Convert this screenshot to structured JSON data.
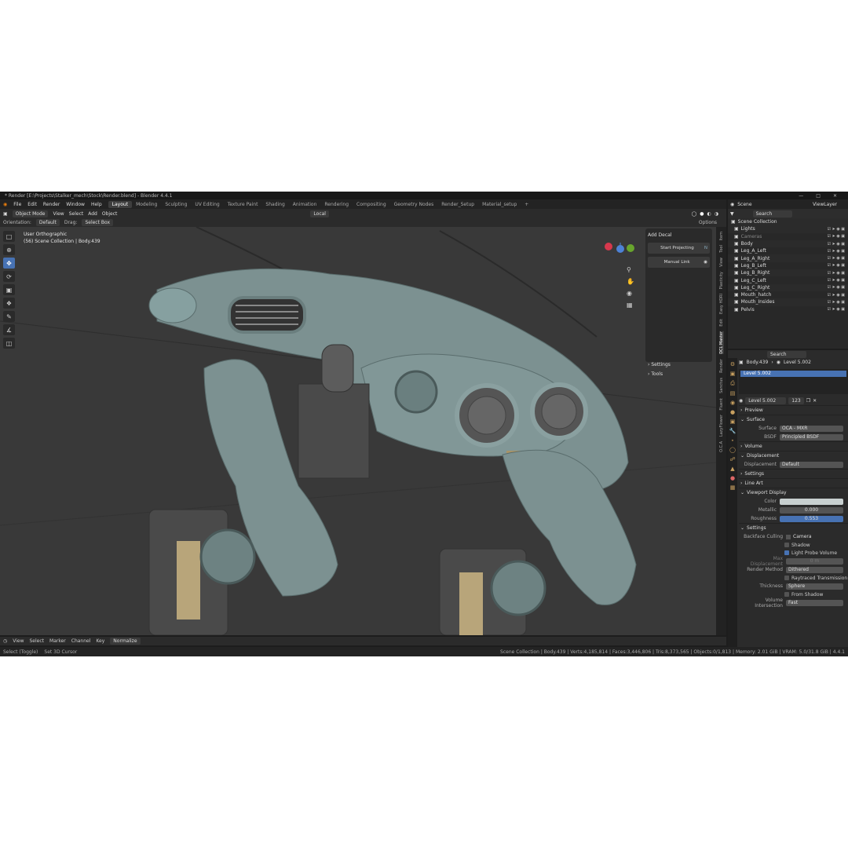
{
  "title": "* Render [E:\\Projects\\Stalker_mech\\Stock\\Render.blend] - Blender 4.4.1",
  "menu": [
    "File",
    "Edit",
    "Render",
    "Window",
    "Help"
  ],
  "workspaces": [
    "Layout",
    "Modeling",
    "Sculpting",
    "UV Editing",
    "Texture Paint",
    "Shading",
    "Animation",
    "Rendering",
    "Compositing",
    "Geometry Nodes",
    "Render_Setup",
    "Material_setup"
  ],
  "header": {
    "mode": "Object Mode",
    "view": "View",
    "select": "Select",
    "add": "Add",
    "object": "Object",
    "transform": "Local",
    "options": "Options"
  },
  "toolhdr": {
    "orientation_label": "Orientation:",
    "orientation": "Default",
    "drag_label": "Drag:",
    "drag": "Select Box"
  },
  "viewport": {
    "view_name": "User Orthographic",
    "collection": "(56) Scene Collection | Body.439"
  },
  "npanel": {
    "title": "Add Decal",
    "start": "Start Projecting",
    "manual": "Manual Link",
    "settings": "Settings",
    "tools": "Tools"
  },
  "ntabs": [
    "Item",
    "Tool",
    "View",
    "Plasticity",
    "Easy HDRI",
    "Edit",
    "DCL Master",
    "Render",
    "Sanctus",
    "Fluent",
    "LazyFlower",
    "O.C.A"
  ],
  "timeline": {
    "view": "View",
    "select": "Select",
    "marker": "Marker",
    "channel": "Channel",
    "key": "Key",
    "normalize": "Normalize"
  },
  "status": {
    "left1": "Select (Toggle)",
    "left2": "Set 3D Cursor",
    "right": "Scene Collection | Body.439 | Verts:4,185,814 | Faces:3,446,806 | Tris:8,373,565 | Objects:0/1,813 | Memory: 2.01 GiB | VRAM: 5.0/31.8 GiB | 4.4.1"
  },
  "outliner": {
    "scene": "Scene",
    "viewlayer": "ViewLayer",
    "search": "Search",
    "root": "Scene Collection",
    "items": [
      "Lights",
      "Cameras",
      "Body",
      "Leg_A_Left",
      "Leg_A_Right",
      "Leg_B_Left",
      "Leg_B_Right",
      "Leg_C_Left",
      "Leg_C_Right",
      "Mouth_hatch",
      "Mouth_Insides",
      "Pelvis"
    ]
  },
  "properties": {
    "search": "Search",
    "object": "Body.439",
    "material": "Level 5.002",
    "slot": "Level 5.002",
    "users": "123",
    "preview": "Preview",
    "surface_sec": "Surface",
    "surface_lbl": "Surface",
    "surface": "OCA - MXR",
    "bsdf_lbl": "BSDF",
    "bsdf": "Principled BSDF",
    "volume": "Volume",
    "displacement_sec": "Displacement",
    "displacement_lbl": "Displacement",
    "displacement": "Default",
    "settings": "Settings",
    "lineart": "Line Art",
    "vpdisplay": "Viewport Display",
    "color_lbl": "Color",
    "metallic_lbl": "Metallic",
    "metallic": "0.000",
    "roughness_lbl": "Roughness",
    "roughness": "0.553",
    "settings2": "Settings",
    "backface_lbl": "Backface Culling",
    "camera": "Camera",
    "shadow": "Shadow",
    "lightprobe": "Light Probe Volume",
    "maxdisp_lbl": "Max Displacement",
    "maxdisp": "0 m",
    "render_method_lbl": "Render Method",
    "render_method": "Dithered",
    "raytrans": "Raytraced Transmission",
    "thickness_lbl": "Thickness",
    "thickness": "Sphere",
    "fromshadow": "From Shadow",
    "volint_lbl": "Volume Intersection",
    "volint": "Fast"
  },
  "colors": {
    "accent": "#4772b3",
    "model": "#7c9191",
    "bg": "#393939"
  }
}
